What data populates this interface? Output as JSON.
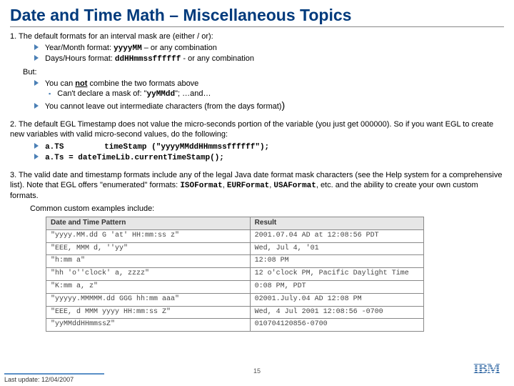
{
  "title": "Date and Time Math – Miscellaneous Topics",
  "s1": {
    "lead": "1. The default formats for an interval mask are (either / or):",
    "a_pre": "Year/Month format: ",
    "a_code": "yyyyMM",
    "a_post": " – or any combination",
    "b_pre": "Days/Hours format: ",
    "b_code": "ddHHmmssffffff",
    "b_post": "  - or any combination",
    "but": "But:",
    "c_pre": "You can ",
    "c_not": "not",
    "c_post": " combine the two formats above",
    "d_pre": "Can't declare a mask of:  \"",
    "d_code": "yyMMdd",
    "d_post": "\";    …and…",
    "e": "You cannot leave out intermediate characters (from the days format)"
  },
  "s2": {
    "lead": "2. The default EGL Timestamp does not value the micro-seconds portion of the variable (you just get 000000). So if you want EGL to create new variables with valid micro-second values, do the following:",
    "a_lhs": "a.TS",
    "a_rhs": "timeStamp (\"yyyyMMddHHmmssffffff\");",
    "b": "a.Ts = dateTimeLib.currentTimeStamp();"
  },
  "s3": {
    "lead_a": "3. The valid date and timestamp formats include any of the legal Java date format mask characters (see the Help system for a comprehensive list).  Note that EGL offers \"enumerated\" formats: ",
    "fmt1": "ISOFormat",
    "fmt2": "EURFormat",
    "fmt3": "USAFormat",
    "lead_b": ", etc. and the ability to create your own custom formats.",
    "sub": "Common custom examples include:",
    "th1": "Date and Time Pattern",
    "th2": "Result",
    "rows": [
      {
        "p": "\"yyyy.MM.dd G 'at' HH:mm:ss z\"",
        "r": "2001.07.04 AD at 12:08:56 PDT"
      },
      {
        "p": "\"EEE, MMM d, ''yy\"",
        "r": "Wed, Jul 4, '01"
      },
      {
        "p": "\"h:mm a\"",
        "r": "12:08 PM"
      },
      {
        "p": "\"hh 'o''clock' a, zzzz\"",
        "r": "12 o'clock PM, Pacific Daylight Time"
      },
      {
        "p": "\"K:mm a, z\"",
        "r": "0:08 PM, PDT"
      },
      {
        "p": "\"yyyyy.MMMMM.dd GGG hh:mm aaa\"",
        "r": "02001.July.04 AD 12:08 PM"
      },
      {
        "p": "\"EEE, d MMM yyyy HH:mm:ss Z\"",
        "r": "Wed, 4 Jul 2001 12:08:56 -0700"
      },
      {
        "p": "\"yyMMddHHmmssZ\"",
        "r": "010704120856-0700"
      }
    ]
  },
  "footer": "Last update: 12/04/2007",
  "page": "15",
  "logo": "IBM"
}
